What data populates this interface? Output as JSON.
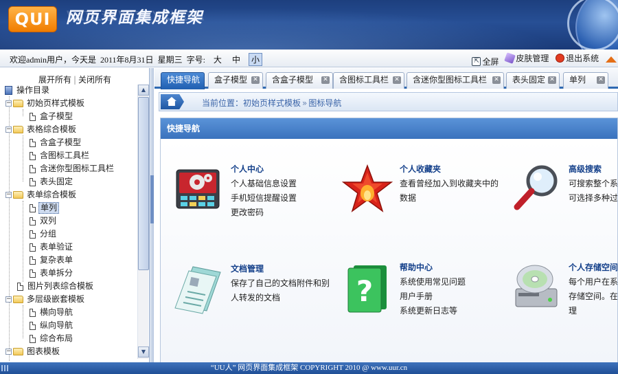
{
  "header": {
    "logo": "QUI",
    "title": "网页界面集成框架"
  },
  "status": {
    "welcome": "欢迎admin用户，今天是",
    "date": "2011年8月31日",
    "weekday": "星期三",
    "font_label": "字号:",
    "font_sizes": [
      "大",
      "中",
      "小"
    ],
    "font_active": "小",
    "links": {
      "fullscreen": "全屏",
      "skin": "皮肤管理",
      "exit": "退出系统"
    }
  },
  "tree": {
    "expand_all": "展开所有",
    "collapse_all": "关闭所有",
    "nodes": [
      {
        "label": "操作目录"
      },
      {
        "label": "初始页样式模板"
      },
      {
        "label": "盒子模型"
      },
      {
        "label": "表格综合模板"
      },
      {
        "label": "含盒子模型"
      },
      {
        "label": "含图标工具栏"
      },
      {
        "label": "含迷你型图标工具栏"
      },
      {
        "label": "表头固定"
      },
      {
        "label": "表单综合模板"
      },
      {
        "label": "单列"
      },
      {
        "label": "双列"
      },
      {
        "label": "分组"
      },
      {
        "label": "表单验证"
      },
      {
        "label": "复杂表单"
      },
      {
        "label": "表单拆分"
      },
      {
        "label": "图片列表综合模板"
      },
      {
        "label": "多层级嵌套模板"
      },
      {
        "label": "横向导航"
      },
      {
        "label": "纵向导航"
      },
      {
        "label": "综合布局"
      },
      {
        "label": "图表模板"
      }
    ],
    "selected": "单列"
  },
  "tabs": [
    "快捷导航",
    "盒子模型",
    "含盒子模型",
    "含图标工具栏",
    "含迷你型图标工具栏",
    "表头固定",
    "单列"
  ],
  "breadcrumb": {
    "prefix": "当前位置：",
    "path1": "初始页样式模板",
    "path2": "图标导航"
  },
  "panel": {
    "title": "快捷导航",
    "items": [
      {
        "title": "个人中心",
        "lines": [
          "个人基础信息设置",
          "手机短信提醒设置",
          "更改密码"
        ],
        "icon": "settings-panel-icon"
      },
      {
        "title": "个人收藏夹",
        "lines": [
          "查看曾经加入到收藏夹中的",
          "数据"
        ],
        "icon": "star-icon"
      },
      {
        "title": "高级搜索",
        "lines": [
          "可搜索整个系",
          "可选择多种过"
        ],
        "icon": "magnifier-icon"
      },
      {
        "title": "文档管理",
        "lines": [
          "保存了自己的文档附件和别",
          "人转发的文档"
        ],
        "icon": "documents-icon"
      },
      {
        "title": "帮助中心",
        "lines": [
          "系统使用常见问题",
          "用户手册",
          "系统更新日志等"
        ],
        "icon": "help-book-icon"
      },
      {
        "title": "个人存储空间",
        "lines": [
          "每个用户在系",
          "存储空间。在",
          "理"
        ],
        "icon": "disk-drive-icon"
      }
    ]
  },
  "footer": {
    "text": "“UU人”  网页界面集成框架  COPYRIGHT 2010 @ www.uur.cn"
  }
}
